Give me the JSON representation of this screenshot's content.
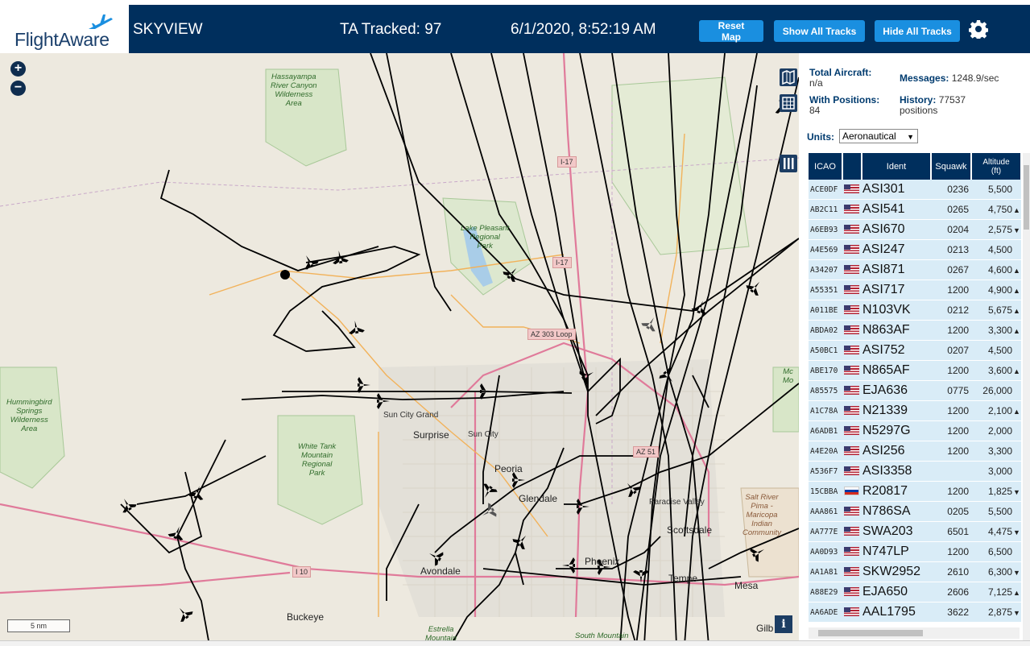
{
  "header": {
    "logo_text": "FlightAware",
    "app_title": "SKYVIEW",
    "ta_tracked": "TA Tracked: 97",
    "datetime": "6/1/2020, 8:52:19 AM",
    "buttons": {
      "reset": "Reset Map",
      "show_all": "Show All Tracks",
      "hide_all": "Hide All Tracks"
    }
  },
  "map": {
    "zoom_in": "+",
    "zoom_out": "−",
    "scale": "5 nm",
    "info": "i",
    "labels": {
      "hassayampa": "Hassayampa\nRiver Canyon\nWilderness\nArea",
      "lake_pleasant": "Lake Pleasant\nRegional\nPark",
      "hummingbird": "Hummingbird\nSprings\nWilderness\nArea",
      "white_tank": "White Tank\nMountain\nRegional\nPark",
      "salt_river": "Salt River\nPima -\nMaricopa\nIndian\nCommunity",
      "mcd": "Mc\nMo",
      "sun_city_grand": "Sun City Grand",
      "surprise": "Surprise",
      "sun_city": "Sun City",
      "peoria": "Peoria",
      "glendale": "Glendale",
      "paradise_valley": "Paradise Valley",
      "scottsdale": "Scottsdale",
      "phoenix": "Phoenix",
      "tempe": "Tempe",
      "mesa": "Mesa",
      "avondale": "Avondale",
      "buckeye": "Buckeye",
      "estrella": "Estrella\nMountain",
      "south_mountain": "South Mountain",
      "gilbert": "Gilb"
    },
    "road_signs": {
      "i17_north": "I-17",
      "i17_mid": "I-17",
      "az303": "AZ 303 Loop",
      "az51": "AZ 51",
      "i10": "I 10"
    }
  },
  "panel": {
    "total_aircraft_label": "Total Aircraft:",
    "total_aircraft_value": "n/a",
    "with_positions_label": "With Positions:",
    "with_positions_value": "84",
    "messages_label": "Messages:",
    "messages_value": "1248.9/sec",
    "history_label": "History:",
    "history_value": "77537",
    "history_unit": "positions",
    "units_label": "Units:",
    "units_value": "Aeronautical",
    "columns": {
      "icao": "ICAO",
      "flag": "",
      "ident": "Ident",
      "squawk": "Squawk",
      "altitude": "Altitude\n(ft)"
    },
    "rows": [
      {
        "icao": "ACE0DF",
        "flag": "us",
        "ident": "ASI301",
        "squawk": "0236",
        "altitude": "5,500",
        "trend": ""
      },
      {
        "icao": "AB2C11",
        "flag": "us",
        "ident": "ASI541",
        "squawk": "0265",
        "altitude": "4,750",
        "trend": "▲"
      },
      {
        "icao": "A6EB93",
        "flag": "us",
        "ident": "ASI670",
        "squawk": "0204",
        "altitude": "2,575",
        "trend": "▼"
      },
      {
        "icao": "A4E569",
        "flag": "us",
        "ident": "ASI247",
        "squawk": "0213",
        "altitude": "4,500",
        "trend": ""
      },
      {
        "icao": "A34207",
        "flag": "us",
        "ident": "ASI871",
        "squawk": "0267",
        "altitude": "4,600",
        "trend": "▲"
      },
      {
        "icao": "A55351",
        "flag": "us",
        "ident": "ASI717",
        "squawk": "1200",
        "altitude": "4,900",
        "trend": "▲"
      },
      {
        "icao": "A011BE",
        "flag": "us",
        "ident": "N103VK",
        "squawk": "0212",
        "altitude": "5,675",
        "trend": "▲"
      },
      {
        "icao": "ABDA02",
        "flag": "us",
        "ident": "N863AF",
        "squawk": "1200",
        "altitude": "3,300",
        "trend": "▲"
      },
      {
        "icao": "A50BC1",
        "flag": "us",
        "ident": "ASI752",
        "squawk": "0207",
        "altitude": "4,500",
        "trend": ""
      },
      {
        "icao": "ABE170",
        "flag": "us",
        "ident": "N865AF",
        "squawk": "1200",
        "altitude": "3,600",
        "trend": "▲"
      },
      {
        "icao": "A85575",
        "flag": "us",
        "ident": "EJA636",
        "squawk": "0775",
        "altitude": "26,000",
        "trend": ""
      },
      {
        "icao": "A1C78A",
        "flag": "us",
        "ident": "N21339",
        "squawk": "1200",
        "altitude": "2,100",
        "trend": "▲"
      },
      {
        "icao": "A6ADB1",
        "flag": "us",
        "ident": "N5297G",
        "squawk": "1200",
        "altitude": "2,000",
        "trend": ""
      },
      {
        "icao": "A4E20A",
        "flag": "us",
        "ident": "ASI256",
        "squawk": "1200",
        "altitude": "3,300",
        "trend": ""
      },
      {
        "icao": "A536F7",
        "flag": "us",
        "ident": "ASI3358",
        "squawk": "",
        "altitude": "3,000",
        "trend": ""
      },
      {
        "icao": "15CBBA",
        "flag": "ru",
        "ident": "R20817",
        "squawk": "1200",
        "altitude": "1,825",
        "trend": "▼"
      },
      {
        "icao": "AAA861",
        "flag": "us",
        "ident": "N786SA",
        "squawk": "0205",
        "altitude": "5,500",
        "trend": ""
      },
      {
        "icao": "AA777E",
        "flag": "us",
        "ident": "SWA203",
        "squawk": "6501",
        "altitude": "4,475",
        "trend": "▼"
      },
      {
        "icao": "AA0D93",
        "flag": "us",
        "ident": "N747LP",
        "squawk": "1200",
        "altitude": "6,500",
        "trend": ""
      },
      {
        "icao": "AA1A81",
        "flag": "us",
        "ident": "SKW2952",
        "squawk": "2610",
        "altitude": "6,300",
        "trend": "▼"
      },
      {
        "icao": "A88E29",
        "flag": "us",
        "ident": "EJA650",
        "squawk": "2606",
        "altitude": "7,125",
        "trend": "▲"
      },
      {
        "icao": "AA6ADE",
        "flag": "us",
        "ident": "AAL1795",
        "squawk": "3622",
        "altitude": "2,875",
        "trend": "▼"
      }
    ]
  },
  "colors": {
    "header_bg": "#002f5d",
    "button_bg": "#1a8fe0",
    "row_bg": "#d9ecf7",
    "map_bg": "#ede9df"
  }
}
